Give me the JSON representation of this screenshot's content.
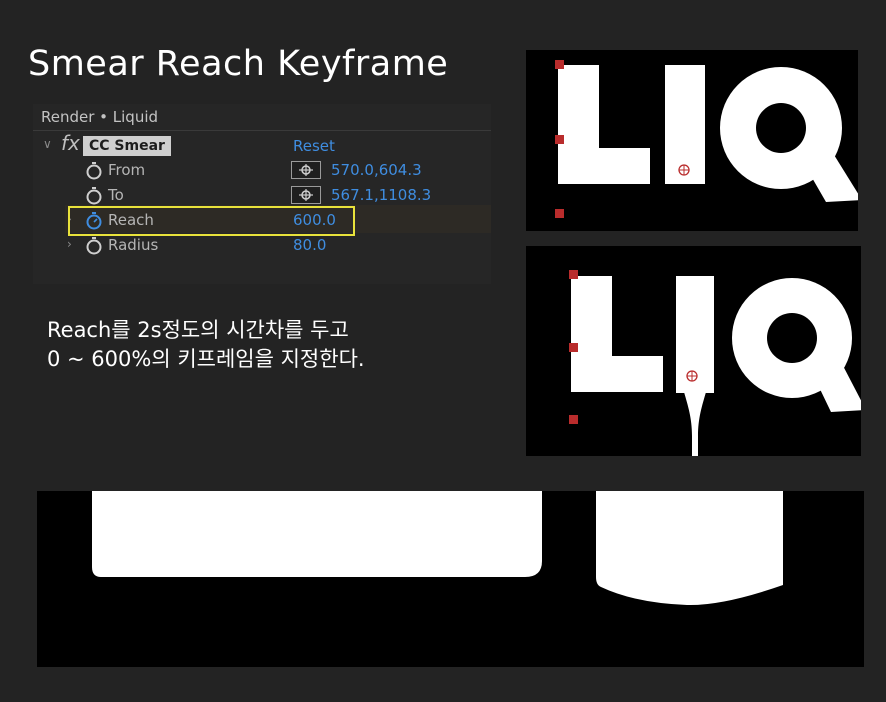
{
  "slide": {
    "title": "Smear Reach Keyframe",
    "description_line1": "Reach를 2s정도의 시간차를 두고",
    "description_line2": "0 ~ 600%의 키프레임을 지정한다."
  },
  "effect_panel": {
    "header": "Render • Liquid",
    "fx_symbol": "fx",
    "effect_name": "CC Smear",
    "reset_label": "Reset",
    "properties": [
      {
        "label": "From",
        "value": "570.0,604.3",
        "icon": "stopwatch-icon",
        "has_target": true
      },
      {
        "label": "To",
        "value": "567.1,1108.3",
        "icon": "stopwatch-icon",
        "has_target": true
      },
      {
        "label": "Reach",
        "value": "600.0",
        "icon": "stopwatch-active-icon",
        "highlighted": true
      },
      {
        "label": "Radius",
        "value": "80.0",
        "icon": "stopwatch-icon"
      }
    ],
    "highlight_color": "#e8e23b",
    "value_color": "#3f8de0"
  },
  "preview_images": [
    {
      "text": "LIQ",
      "state": "before-smear"
    },
    {
      "text": "LIQ",
      "state": "after-smear"
    },
    {
      "state": "zoomed-smear-detail"
    }
  ]
}
